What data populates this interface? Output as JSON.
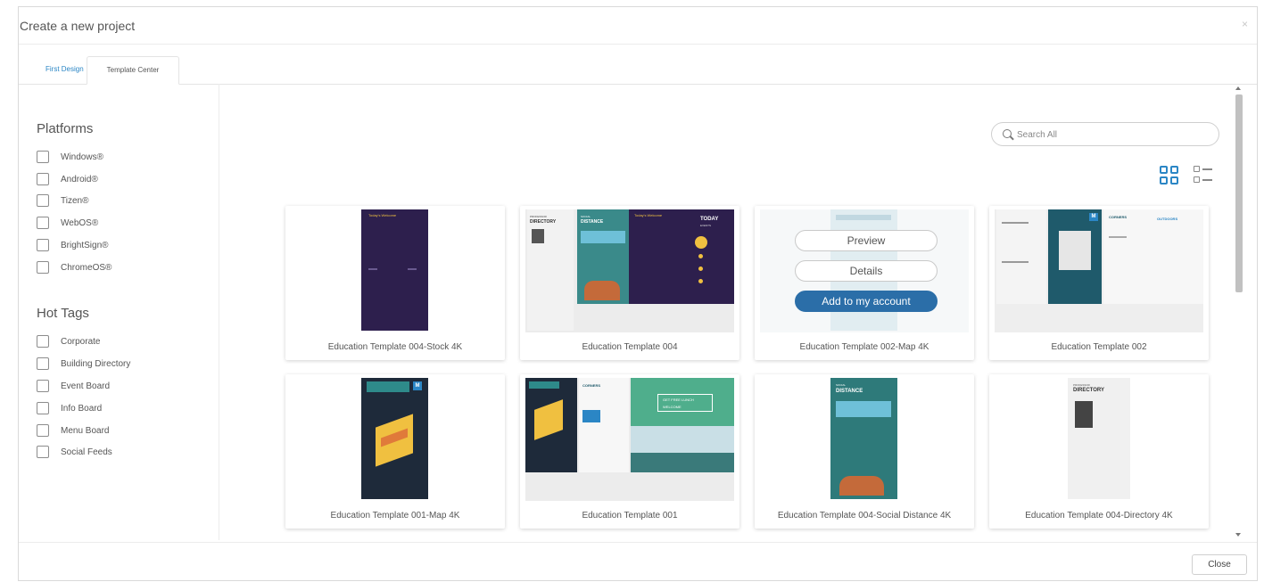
{
  "dialog": {
    "title": "Create a new project",
    "close_symbol": "×",
    "close_button": "Close"
  },
  "tabs": [
    {
      "label": "First Design",
      "active": false
    },
    {
      "label": "Template Center",
      "active": true
    }
  ],
  "filters": {
    "platforms_title": "Platforms",
    "platforms": [
      "Windows®",
      "Android®",
      "Tizen®",
      "WebOS®",
      "BrightSign®",
      "ChromeOS®"
    ],
    "hot_tags_title": "Hot Tags",
    "hot_tags": [
      "Corporate",
      "Building Directory",
      "Event Board",
      "Info Board",
      "Menu Board",
      "Social Feeds"
    ]
  },
  "search": {
    "placeholder": "Search All",
    "icon": "search-icon"
  },
  "view_modes": {
    "grid_icon": "grid-view-icon",
    "list_icon": "list-view-icon",
    "active": "grid"
  },
  "accent_color": "#2b86c5",
  "templates": [
    {
      "name": "Education Template 004-Stock 4K"
    },
    {
      "name": "Education Template 004"
    },
    {
      "name": "Education Template 002-Map 4K",
      "hovered": true
    },
    {
      "name": "Education Template 002"
    },
    {
      "name": "Education Template 001-Map 4K"
    },
    {
      "name": "Education Template 001"
    },
    {
      "name": "Education Template 004-Social Distance 4K"
    },
    {
      "name": "Education Template 004-Directory 4K"
    }
  ],
  "hover_actions": {
    "preview": "Preview",
    "details": "Details",
    "add": "Add to my account"
  },
  "thumb_text": {
    "today_welcome": "Today's Welcome",
    "directory_small": "PROFESSOR",
    "directory": "DIRECTORY",
    "social": "SOCIAL",
    "distance": "DISTANCE",
    "today": "TODAY",
    "events": "EVENTS",
    "corners": "CORNERS",
    "our_campus": "OUR CAMPUS",
    "outdoors": "OUTDOORS",
    "m": "M",
    "get_free_lunch": "GET FREE LUNCH",
    "welcome": "WELCOME"
  }
}
